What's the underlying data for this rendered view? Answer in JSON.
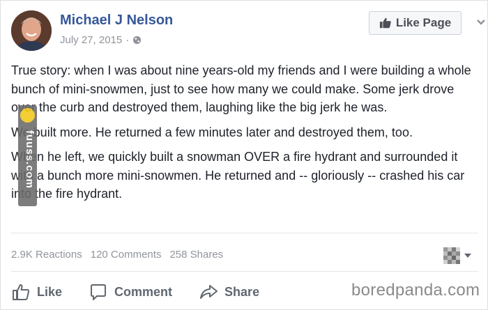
{
  "post": {
    "author": "Michael J Nelson",
    "date": "July 27, 2015",
    "separator": "·",
    "privacy_icon": "globe-icon",
    "like_page_label": "Like Page",
    "paragraphs": [
      "True story: when I was about nine years-old my friends and I were building a whole bunch of mini-snowmen, just to see how many we could make. Some jerk drove over the curb and destroyed them, laughing like the big jerk he was.",
      "We built more. He returned a few minutes later and destroyed them, too.",
      "When he left, we quickly built a snowman OVER a fire hydrant and surrounded it with a bunch more mini-snowmen. He returned and -- gloriously -- crashed his car into the fire hydrant."
    ]
  },
  "watermark": {
    "text": "fuuss.com"
  },
  "stats": {
    "reactions": "2.9K Reactions",
    "comments": "120 Comments",
    "shares": "258 Shares"
  },
  "actions": {
    "like": "Like",
    "comment": "Comment",
    "share": "Share"
  },
  "credit": "boredpanda.com",
  "colors": {
    "author_link": "#365899",
    "muted": "#90949c",
    "action": "#606770"
  }
}
